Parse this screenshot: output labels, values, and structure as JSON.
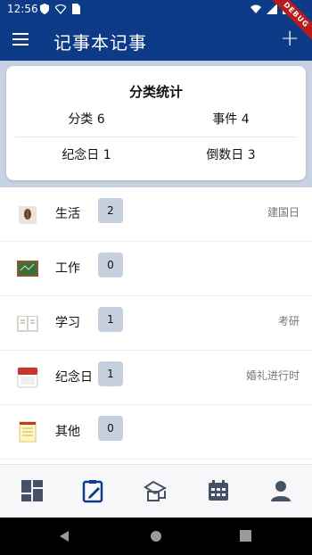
{
  "status_bar": {
    "time": "12:56",
    "debug_label": "DEBUG"
  },
  "app_bar": {
    "title": "记事本记事",
    "add_symbol": "+"
  },
  "summary": {
    "title": "分类统计",
    "category_count": "分类 6",
    "event_count": "事件 4",
    "anniversary_count": "纪念日 1",
    "countdown_count": "倒数日 3"
  },
  "categories": [
    {
      "label": "生活",
      "count": "2",
      "note": "建国日",
      "icon": "coffee-icon"
    },
    {
      "label": "工作",
      "count": "0",
      "note": "",
      "icon": "chalkboard-icon"
    },
    {
      "label": "学习",
      "count": "1",
      "note": "考研",
      "icon": "book-icon"
    },
    {
      "label": "纪念日",
      "count": "1",
      "note": "婚礼进行时",
      "icon": "calendar-date-icon"
    },
    {
      "label": "其他",
      "count": "0",
      "note": "",
      "icon": "notepad-icon"
    }
  ],
  "colors": {
    "primary": "#0d3b88",
    "badge": "#c5cfdd",
    "summary_bg": "#c9d2e2"
  },
  "bottom_nav": {
    "items": [
      "dashboard-icon",
      "edit-note-icon",
      "wedding-icon",
      "calendar-icon",
      "person-icon"
    ],
    "active_index": 1
  }
}
